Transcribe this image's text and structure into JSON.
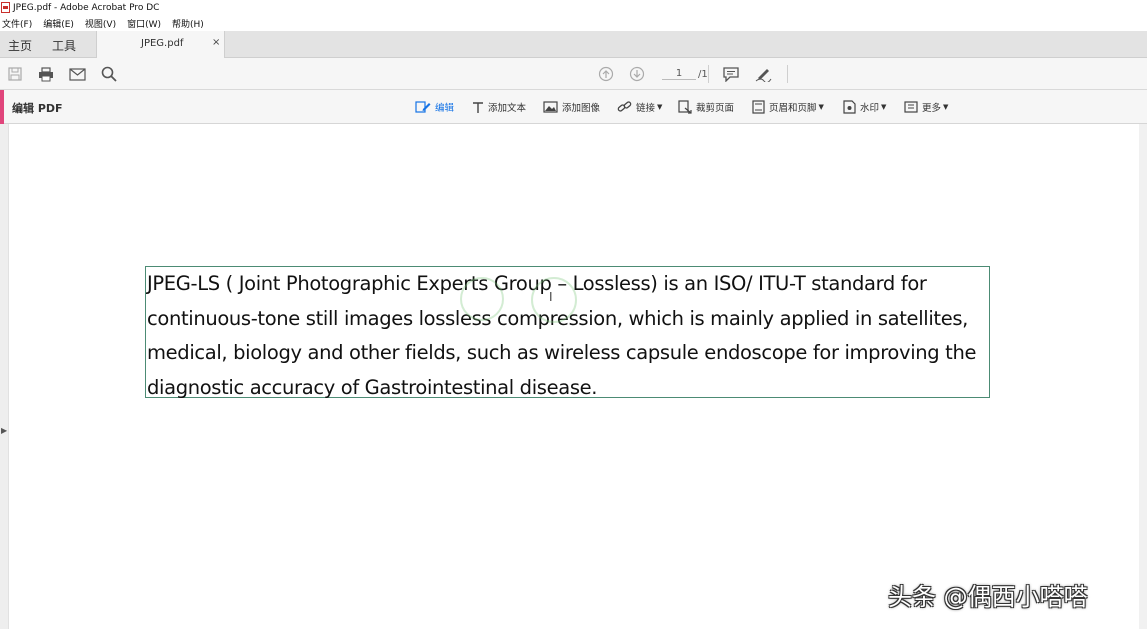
{
  "window": {
    "title": "JPEG.pdf - Adobe Acrobat Pro DC"
  },
  "menu": {
    "items": [
      "文件(F)",
      "编辑(E)",
      "视图(V)",
      "窗口(W)",
      "帮助(H)"
    ]
  },
  "tabs": {
    "home": "主页",
    "tools": "工具",
    "doc": "JPEG.pdf",
    "close": "×"
  },
  "toolbar": {
    "page_current": "1",
    "page_total": "/1",
    "icons": [
      "save-icon",
      "print-icon",
      "email-icon",
      "search-icon",
      "page-up-icon",
      "page-down-icon",
      "comment-icon",
      "sign-icon"
    ]
  },
  "edit_bar": {
    "title": "编辑 PDF",
    "tools": {
      "edit": "编辑",
      "add_text": "添加文本",
      "add_image": "添加图像",
      "link": "链接",
      "crop": "裁剪页面",
      "header_footer": "页眉和页脚",
      "watermark": "水印",
      "more": "更多"
    }
  },
  "document": {
    "body_text": "JPEG-LS ( Joint Photographic Experts Group – Lossless) is an ISO/ ITU-T standard for continuous-tone still images lossless compression, which is mainly applied in satellites, medical, biology and other fields, such as wireless capsule endoscope for improving the diagnostic accuracy of Gastrointestinal disease."
  },
  "watermark": {
    "text": "头条 @偶西小嗒嗒"
  },
  "colors": {
    "accent": "#e0457b",
    "active_tool": "#1473e6",
    "text_box_border": "#4c8b74"
  }
}
